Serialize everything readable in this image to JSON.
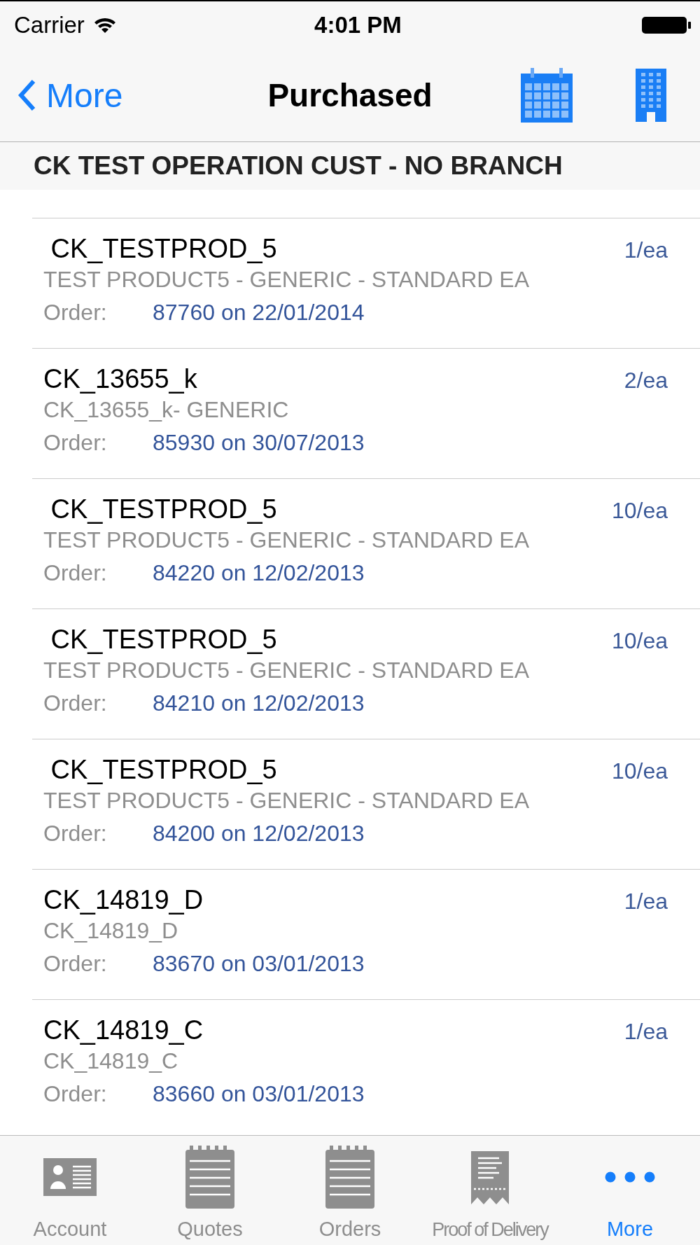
{
  "status_bar": {
    "carrier": "Carrier",
    "time": "4:01 PM"
  },
  "nav_bar": {
    "back_label": "More",
    "title": "Purchased"
  },
  "section_header": "CK TEST OPERATION CUST - NO BRANCH",
  "items": [
    {
      "code": " CK_TESTPROD_5",
      "quantity": "1/ea",
      "description": "TEST PRODUCT5 - GENERIC - STANDARD EA",
      "order_label": "Order:",
      "order": "87760 on 22/01/2014"
    },
    {
      "code": "CK_13655_k",
      "quantity": "2/ea",
      "description": "CK_13655_k- GENERIC",
      "order_label": "Order:",
      "order": "85930 on 30/07/2013"
    },
    {
      "code": " CK_TESTPROD_5",
      "quantity": "10/ea",
      "description": "TEST PRODUCT5 - GENERIC - STANDARD EA",
      "order_label": "Order:",
      "order": "84220 on 12/02/2013"
    },
    {
      "code": " CK_TESTPROD_5",
      "quantity": "10/ea",
      "description": "TEST PRODUCT5 - GENERIC - STANDARD EA",
      "order_label": "Order:",
      "order": "84210 on 12/02/2013"
    },
    {
      "code": " CK_TESTPROD_5",
      "quantity": "10/ea",
      "description": "TEST PRODUCT5 - GENERIC - STANDARD EA",
      "order_label": "Order:",
      "order": "84200 on 12/02/2013"
    },
    {
      "code": "CK_14819_D",
      "quantity": "1/ea",
      "description": "CK_14819_D",
      "order_label": "Order:",
      "order": "83670 on 03/01/2013"
    },
    {
      "code": "CK_14819_C",
      "quantity": "1/ea",
      "description": "CK_14819_C",
      "order_label": "Order:",
      "order": "83660 on 03/01/2013"
    }
  ],
  "tab_bar": [
    {
      "kind": "account",
      "label": "Account",
      "selected": false
    },
    {
      "kind": "quotes",
      "label": "Quotes",
      "selected": false
    },
    {
      "kind": "orders",
      "label": "Orders",
      "selected": false
    },
    {
      "kind": "delivery",
      "label": "Proof of Delivery",
      "selected": false
    },
    {
      "kind": "more",
      "label": "More",
      "selected": true
    }
  ]
}
